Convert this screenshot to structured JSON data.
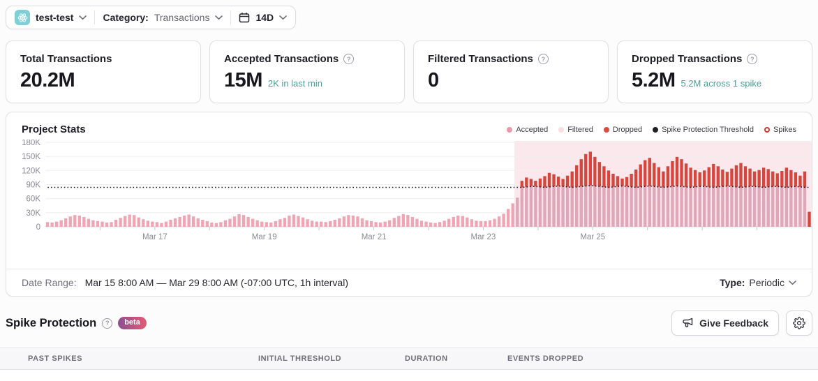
{
  "topbar": {
    "project_name": "test-test",
    "category_label": "Category:",
    "category_value": "Transactions",
    "period": "14D"
  },
  "cards": [
    {
      "title": "Total Transactions",
      "value": "20.2M",
      "subtitle": ""
    },
    {
      "title": "Accepted Transactions",
      "value": "15M",
      "subtitle": "2K in last min"
    },
    {
      "title": "Filtered Transactions",
      "value": "0",
      "subtitle": ""
    },
    {
      "title": "Dropped Transactions",
      "value": "5.2M",
      "subtitle": "5.2M across 1 spike"
    }
  ],
  "chart": {
    "title": "Project Stats"
  },
  "chart_data": {
    "type": "bar",
    "title": "Project Stats",
    "x_range": "Mar 15 8:00 AM – Mar 29 8:00 AM (-07:00 UTC)",
    "interval_per_bar_hours": 2,
    "ylim_k": [
      0,
      180
    ],
    "grid": "horizontal",
    "legend_position": "top-right",
    "legend": [
      {
        "label": "Accepted",
        "marker": "dot",
        "color": "#e89aac"
      },
      {
        "label": "Filtered",
        "marker": "dot",
        "color": "#f8dde3"
      },
      {
        "label": "Dropped",
        "marker": "dot",
        "color": "#de4b41"
      },
      {
        "label": "Spike Protection Threshold",
        "marker": "dot",
        "color": "#1f1f24"
      },
      {
        "label": "Spikes",
        "marker": "ring",
        "color": "#d2372e"
      }
    ],
    "y_ticks": [
      {
        "v": 0,
        "label": "0"
      },
      {
        "v": 30,
        "label": "30K"
      },
      {
        "v": 60,
        "label": "60K"
      },
      {
        "v": 90,
        "label": "90K"
      },
      {
        "v": 120,
        "label": "120K"
      },
      {
        "v": 150,
        "label": "150K"
      },
      {
        "v": 180,
        "label": "180K"
      }
    ],
    "x_ticks": [
      {
        "idx": 24,
        "label": "Mar 17"
      },
      {
        "idx": 48,
        "label": "Mar 19"
      },
      {
        "idx": 72,
        "label": "Mar 21"
      },
      {
        "idx": 96,
        "label": "Mar 23"
      },
      {
        "idx": 120,
        "label": "Mar 25"
      }
    ],
    "minor_tick_every": 12,
    "threshold_k": 84,
    "pre_spike_accepted_k": [
      10,
      9,
      11,
      14,
      18,
      22,
      25,
      24,
      21,
      17,
      14,
      12,
      11,
      9,
      10,
      15,
      19,
      23,
      26,
      25,
      20,
      16,
      13,
      11,
      10,
      8,
      11,
      15,
      18,
      21,
      24,
      26,
      22,
      18,
      15,
      12,
      9,
      8,
      10,
      14,
      17,
      22,
      27,
      25,
      21,
      17,
      14,
      11,
      10,
      9,
      12,
      16,
      19,
      24,
      26,
      23,
      20,
      16,
      13,
      11,
      11,
      10,
      12,
      15,
      18,
      22,
      25,
      24,
      22,
      18,
      14,
      12,
      10,
      9,
      11,
      14,
      19,
      23,
      27,
      25,
      21,
      17,
      13,
      11,
      9,
      8,
      10,
      13,
      17,
      21,
      24,
      23,
      20,
      16,
      13,
      12,
      12,
      14,
      17,
      22,
      28,
      38,
      50
    ],
    "spike_accepted_k": [
      62,
      84,
      85,
      86,
      86,
      85,
      84,
      85,
      86,
      87,
      86,
      85,
      84,
      85,
      86,
      87,
      88,
      87,
      86,
      85,
      84,
      85,
      86,
      87,
      86,
      85,
      84,
      85,
      86,
      87,
      86,
      85,
      84,
      85,
      86,
      87,
      86,
      85,
      84,
      85,
      86,
      86,
      85,
      84,
      85,
      86,
      87,
      86,
      85,
      84,
      85,
      86,
      86,
      85,
      84,
      85,
      86,
      86,
      85,
      84,
      85,
      86,
      85,
      84,
      0
    ],
    "spike_dropped_k": [
      0,
      14,
      20,
      16,
      12,
      18,
      24,
      30,
      26,
      20,
      16,
      24,
      34,
      46,
      58,
      68,
      72,
      62,
      52,
      44,
      36,
      28,
      22,
      16,
      20,
      28,
      38,
      48,
      56,
      60,
      50,
      42,
      34,
      44,
      54,
      62,
      58,
      50,
      42,
      36,
      30,
      34,
      42,
      50,
      44,
      36,
      30,
      38,
      46,
      52,
      44,
      38,
      32,
      36,
      42,
      38,
      32,
      28,
      34,
      42,
      36,
      30,
      24,
      34,
      32
    ],
    "colors": {
      "accepted": "#f0a5b4",
      "accepted_spike": "#e0a6ba",
      "dropped": "#d8453d",
      "threshold": "#1b1b20",
      "spike_bg": "#fbe8ec",
      "grid": "#efeff2",
      "axis": "#d8d8de",
      "tick": "#c6c6cd"
    }
  },
  "footer": {
    "date_range_label": "Date Range:",
    "date_range_value": "Mar 15 8:00 AM — Mar 29 8:00 AM (-07:00 UTC, 1h interval)",
    "type_label": "Type:",
    "type_value": "Periodic"
  },
  "spike_section": {
    "title": "Spike Protection",
    "beta_label": "beta",
    "feedback_label": "Give Feedback"
  },
  "table": {
    "headers": [
      "Past Spikes",
      "Initial Threshold",
      "Duration",
      "Events Dropped"
    ]
  }
}
